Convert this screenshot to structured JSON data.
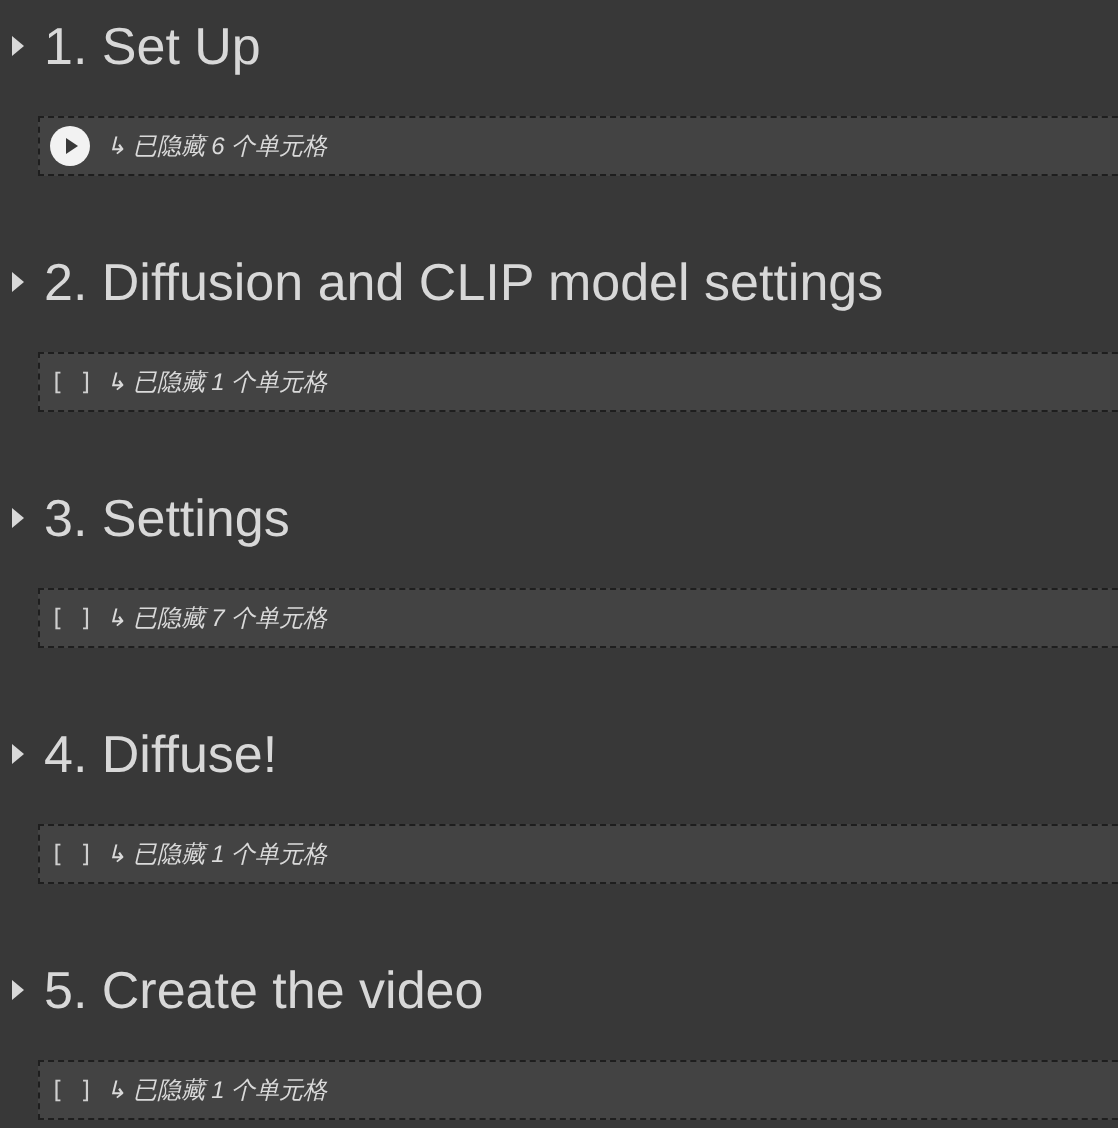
{
  "sections": [
    {
      "title": "1. Set Up",
      "expanded": false,
      "cell": {
        "kind": "run",
        "text": "↳ 已隐藏 6 个单元格"
      }
    },
    {
      "title": "2. Diffusion and CLIP model settings",
      "expanded": false,
      "cell": {
        "kind": "idle",
        "bracket": "[ ]",
        "text": "↳ 已隐藏 1 个单元格"
      }
    },
    {
      "title": "3. Settings",
      "expanded": false,
      "cell": {
        "kind": "idle",
        "bracket": "[ ]",
        "text": "↳ 已隐藏 7 个单元格"
      }
    },
    {
      "title": "4. Diffuse!",
      "expanded": false,
      "cell": {
        "kind": "idle",
        "bracket": "[ ]",
        "text": "↳ 已隐藏 1 个单元格"
      }
    },
    {
      "title": "5. Create the video",
      "expanded": false,
      "cell": {
        "kind": "idle",
        "bracket": "[ ]",
        "text": "↳ 已隐藏 1 个单元格"
      }
    }
  ]
}
